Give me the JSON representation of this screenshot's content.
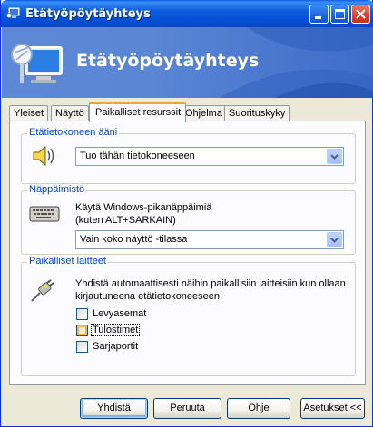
{
  "window": {
    "title": "Etätyöpöytäyhteys",
    "banner_title": "Etätyöpöytäyhteys"
  },
  "tabs": [
    {
      "label": "Yleiset",
      "active": false
    },
    {
      "label": "Näyttö",
      "active": false
    },
    {
      "label": "Paikalliset resurssit",
      "active": true
    },
    {
      "label": "Ohjelma",
      "active": false
    },
    {
      "label": "Suorituskyky",
      "active": false
    }
  ],
  "sound": {
    "group_label": "Etätietokoneen ääni",
    "icon": "speaker-icon",
    "selected": "Tuo tähän tietokoneeseen"
  },
  "keyboard": {
    "group_label": "Näppäimistö",
    "icon": "keyboard-icon",
    "description_line1": "Käytä Windows-pikanäppäimiä",
    "description_line2": "(kuten ALT+SARKAIN)",
    "selected": "Vain koko näyttö -tilassa"
  },
  "devices": {
    "group_label": "Paikalliset laitteet",
    "icon": "plug-icon",
    "description_line1": "Yhdistä automaattisesti näihin paikallisiin laitteisiin kun ollaan",
    "description_line2": "kirjautuneena etätietokoneeseen:",
    "items": [
      {
        "label": "Levyasemat",
        "checked": false
      },
      {
        "label": "Tulostimet",
        "checked": false
      },
      {
        "label": "Sarjaportit",
        "checked": false
      }
    ]
  },
  "buttons": {
    "connect": "Yhdistä",
    "cancel": "Peruuta",
    "help": "Ohje",
    "options": "Asetukset <<"
  },
  "colors": {
    "titlebar": "#0A5FE3",
    "group_title": "#0046D5",
    "active_tab_accent": "#E7A63C"
  }
}
